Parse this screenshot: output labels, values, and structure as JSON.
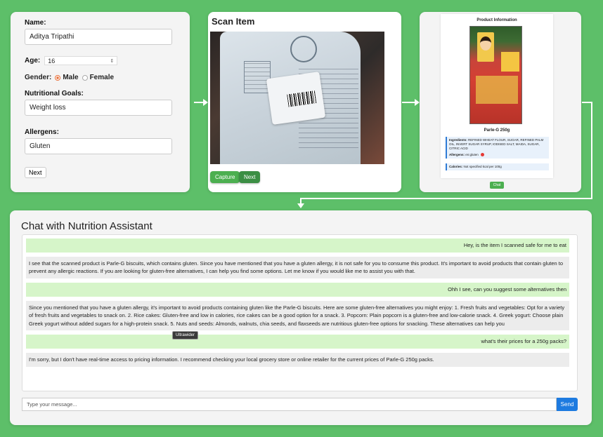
{
  "form": {
    "name_label": "Name:",
    "name_value": "Aditya Tripathi",
    "age_label": "Age:",
    "age_value": "16",
    "gender_label": "Gender:",
    "gender_options": [
      "Male",
      "Female"
    ],
    "gender_selected": "Male",
    "goals_label": "Nutritional Goals:",
    "goals_value": "Weight loss",
    "allergens_label": "Allergens:",
    "allergens_value": "Gluten",
    "next_label": "Next"
  },
  "scan": {
    "title": "Scan Item",
    "capture_label": "Capture",
    "next_label": "Next"
  },
  "product": {
    "header": "Product Information",
    "name": "Parle-G 250g",
    "ingredients_key": "Ingredients:",
    "ingredients_value": "REFINED WHEAT FLOUR, SUGAR, REFINED PALM OIL, INVERT SUGAR SYRUP, IODISED SALT, MAIDA, SUGAR, CITRIC ACID",
    "allergens_key": "Allergens:",
    "allergens_value": "en:gluten",
    "calories_key": "Calories:",
    "calories_value": "Not specified kcal per 100g",
    "chat_label": "Chat"
  },
  "chat": {
    "title": "Chat with Nutrition Assistant",
    "messages": [
      {
        "role": "user",
        "text": "Hey, is the item I scanned safe for me to eat"
      },
      {
        "role": "bot",
        "text": "I see that the scanned product is Parle-G biscuits, which contains gluten. Since you have mentioned that you have a gluten allergy, it is not safe for you to consume this product. It's important to avoid products that contain gluten to prevent any allergic reactions. If you are looking for gluten-free alternatives, I can help you find some options. Let me know if you would like me to assist you with that."
      },
      {
        "role": "user",
        "text": "Ohh I see, can you suggest some alternatives then"
      },
      {
        "role": "bot",
        "text": "Since you mentioned that you have a gluten allergy, it's important to avoid products containing gluten like the Parle-G biscuits. Here are some gluten-free alternatives you might enjoy: 1. Fresh fruits and vegetables: Opt for a variety of fresh fruits and vegetables to snack on. 2. Rice cakes: Gluten-free and low in calories, rice cakes can be a good option for a snack. 3. Popcorn: Plain popcorn is a gluten-free and low-calorie snack. 4. Greek yogurt: Choose plain Greek yogurt without added sugars for a high-protein snack. 5. Nuts and seeds: Almonds, walnuts, chia seeds, and flaxseeds are nutritious gluten-free options for snacking. These alternatives can help you"
      },
      {
        "role": "user",
        "text": "what's their prices for a 250g packs?"
      },
      {
        "role": "bot",
        "text": "I'm sorry, but I don't have real-time access to pricing information. I recommend checking your local grocery store or online retailer for the current prices of Parle-G 250g packs."
      }
    ],
    "tooltip": "Ultrawider",
    "input_placeholder": "Type your message...",
    "send_label": "Send"
  }
}
